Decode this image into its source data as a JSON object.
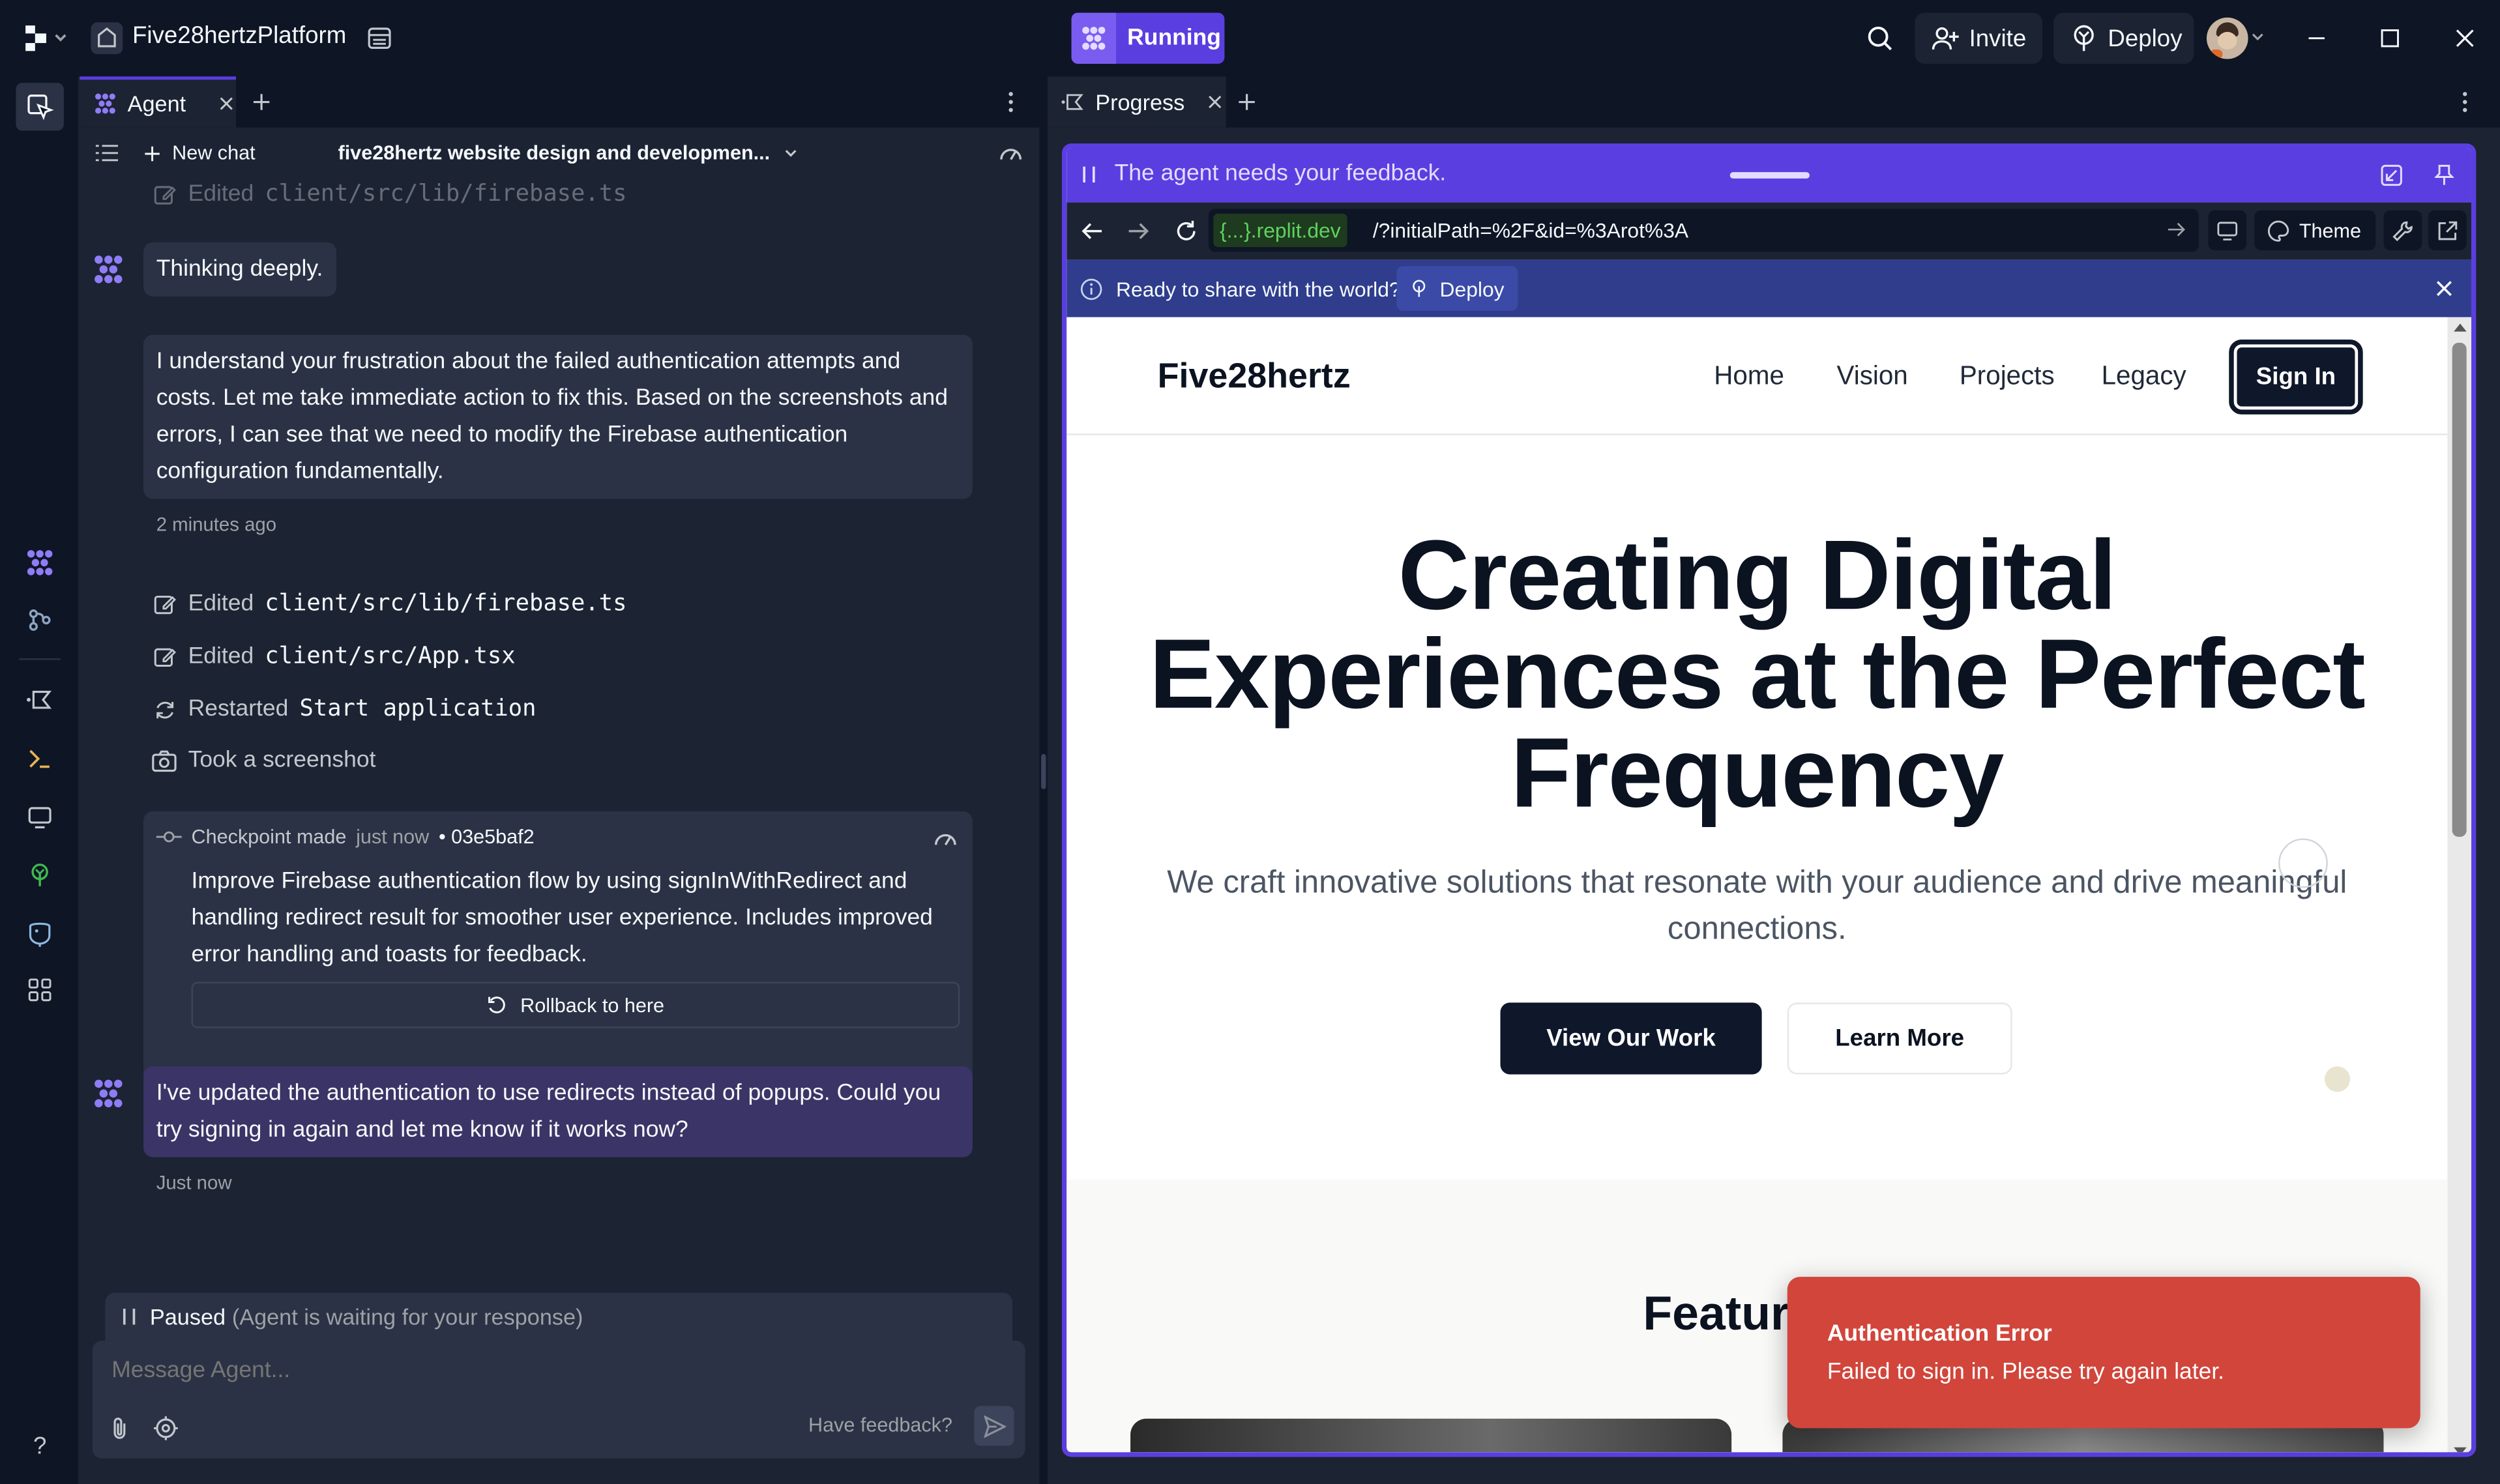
{
  "app": {
    "project_name": "Five28hertzPlatform",
    "run_label": "Running",
    "invite_label": "Invite",
    "deploy_label": "Deploy"
  },
  "agent": {
    "tab_label": "Agent",
    "new_chat_label": "New chat",
    "chat_title": "five28hertz website design and developmen...",
    "faded_action": {
      "prefix": "Edited",
      "file": "client/src/lib/firebase.ts"
    },
    "thinking": "Thinking deeply.",
    "message1": "I understand your frustration about the failed authentication attempts and costs. Let me take immediate action to fix this. Based on the screenshots and errors, I can see that we need to modify the Firebase authentication configuration fundamentally.",
    "message1_time": "2 minutes ago",
    "actions": [
      {
        "prefix": "Edited",
        "target": "client/src/lib/firebase.ts",
        "icon": "edit-icon"
      },
      {
        "prefix": "Edited",
        "target": "client/src/App.tsx",
        "icon": "edit-icon"
      },
      {
        "prefix": "Restarted",
        "target": "Start application",
        "icon": "restart-icon"
      },
      {
        "prefix": "Took a screenshot",
        "target": "",
        "icon": "camera-icon"
      }
    ],
    "checkpoint": {
      "label": "Checkpoint made",
      "time": "just now",
      "hash": "• 03e5baf2",
      "description": "Improve Firebase authentication flow by using signInWithRedirect and handling redirect result for smoother user experience. Includes improved error handling and toasts for feedback.",
      "rollback_label": "Rollback to here"
    },
    "message2": "I've updated the authentication to use redirects instead of popups. Could you try signing in again and let me know if it works now?",
    "message2_time": "Just now",
    "paused_label": "Paused",
    "paused_detail": "(Agent is waiting for your response)",
    "input_placeholder": "Message Agent...",
    "feedback_label": "Have feedback?"
  },
  "progress": {
    "tab_label": "Progress",
    "feedback_banner": "The agent needs your feedback.",
    "url_domain": "{...}.replit.dev",
    "url_path": "/?initialPath=%2F&id=%3Arot%3A",
    "theme_label": "Theme",
    "share_prompt": "Ready to share with the world?",
    "deploy_label": "Deploy"
  },
  "site": {
    "brand": "Five28hertz",
    "nav": [
      "Home",
      "Vision",
      "Projects",
      "Legacy"
    ],
    "signin_label": "Sign In",
    "hero_line1": "Creating Digital",
    "hero_line2": "Experiences at the Perfect",
    "hero_line3": "Frequency",
    "subtitle": "We craft innovative solutions that resonate with your audience and drive meaningful connections.",
    "primary_cta": "View Our Work",
    "secondary_cta": "Learn More",
    "featured_heading": "Featured P"
  },
  "toast": {
    "title": "Authentication Error",
    "message": "Failed to sign in. Please try again later."
  },
  "colors": {
    "accent": "#5b3ee0",
    "error": "#d1453b",
    "bg": "#0e1525",
    "panel": "#1c2333"
  }
}
